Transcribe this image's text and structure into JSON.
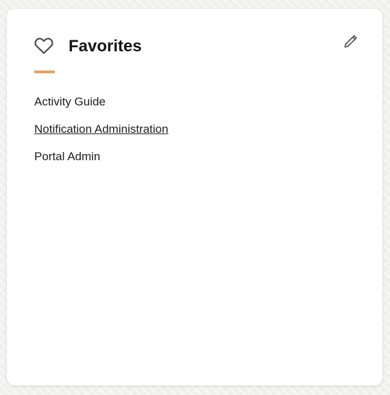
{
  "widget": {
    "title": "Favorites",
    "icon": "heart-outline-icon",
    "edit_icon": "pencil-icon",
    "accent_color": "#e9a159"
  },
  "favorites": [
    {
      "label": "Activity Guide",
      "underlined": false
    },
    {
      "label": "Notification Administration",
      "underlined": true
    },
    {
      "label": "Portal Admin",
      "underlined": false
    }
  ]
}
